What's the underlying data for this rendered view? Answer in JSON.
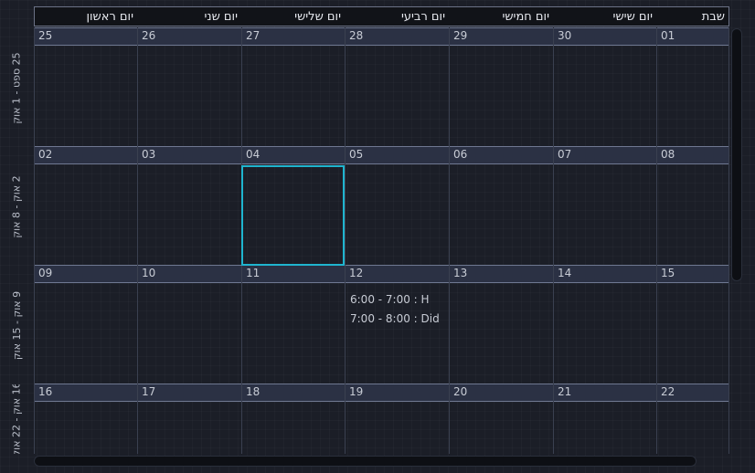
{
  "day_names": [
    "יום ראשון",
    "יום שני",
    "יום שלישי",
    "יום רביעי",
    "יום חמישי",
    "יום שישי",
    "שבת"
  ],
  "weeks": [
    {
      "label": "25 ספט - 1 אוק",
      "days": [
        "25",
        "26",
        "27",
        "28",
        "29",
        "30",
        "01"
      ]
    },
    {
      "label": "2 אוק - 8 אוק",
      "days": [
        "02",
        "03",
        "04",
        "05",
        "06",
        "07",
        "08"
      ]
    },
    {
      "label": "9 אוק - 15 אוק",
      "days": [
        "09",
        "10",
        "11",
        "12",
        "13",
        "14",
        "15"
      ]
    },
    {
      "label": "16 אוק - 22 אוק",
      "days": [
        "16",
        "17",
        "18",
        "19",
        "20",
        "21",
        "22"
      ]
    }
  ],
  "selected_day": "04",
  "events": [
    {
      "day": "12",
      "text": "6:00 - 7:00 : H"
    },
    {
      "day": "12",
      "text": "7:00 - 8:00 : Did"
    }
  ]
}
